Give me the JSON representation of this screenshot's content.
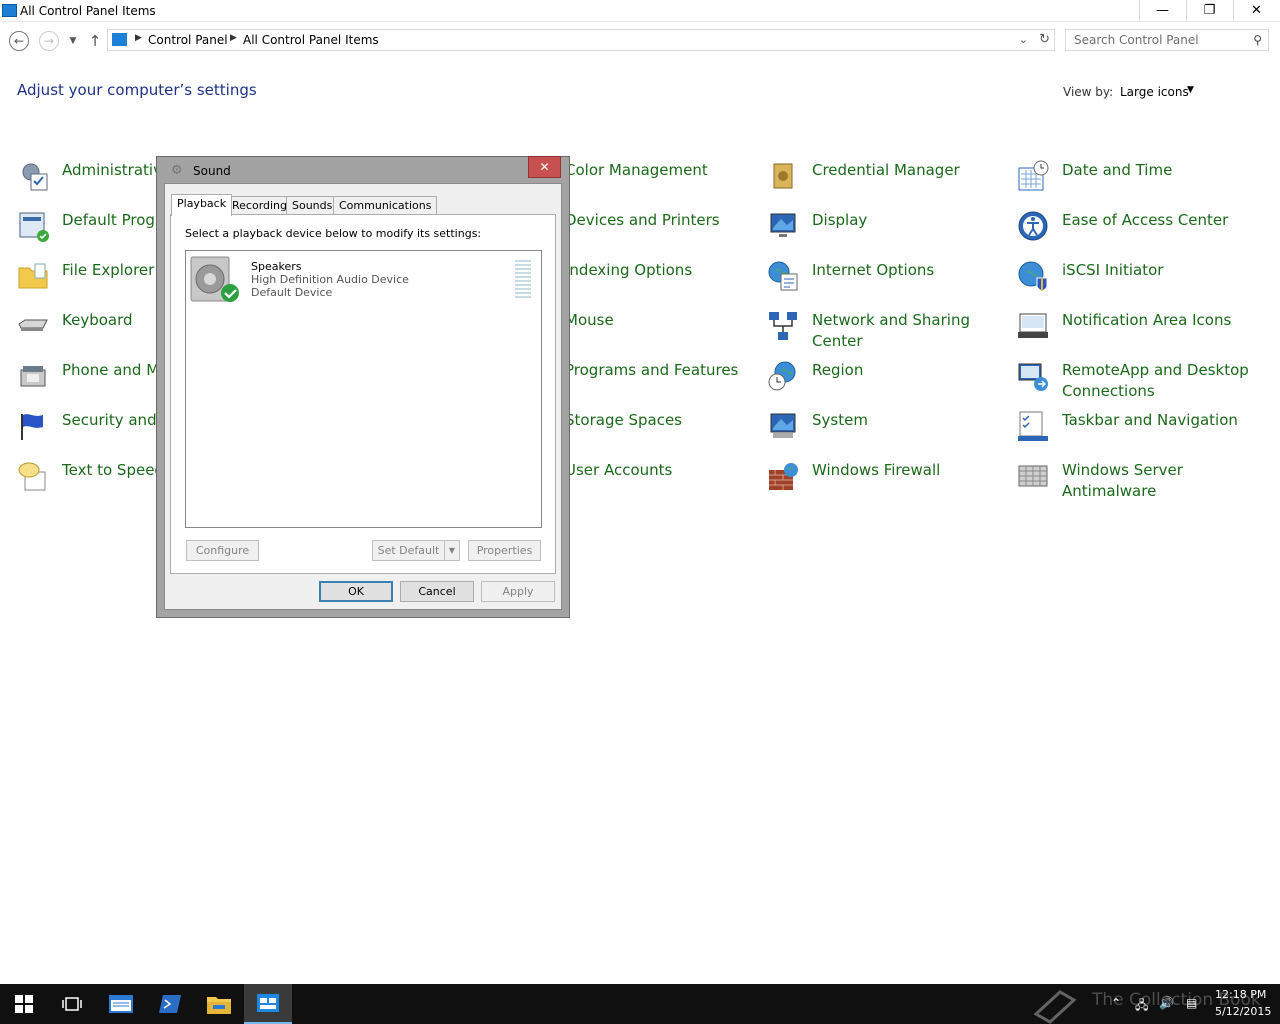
{
  "window": {
    "title": "All Control Panel Items",
    "minimize": "—",
    "restore": "❐",
    "close": "✕"
  },
  "address_bar": {
    "crumbs": [
      "Control Panel",
      "All Control Panel Items"
    ],
    "search_placeholder": "Search Control Panel"
  },
  "header": {
    "title": "Adjust your computer’s settings",
    "view_by_label": "View by:",
    "view_by_value": "Large icons"
  },
  "items": {
    "col1": [
      "Administrative",
      "Default Progr",
      "File Explorer O",
      "Keyboard",
      "Phone and M",
      "Security and M",
      "Text to Speech"
    ],
    "col2": [
      "Color Management",
      "Devices and Printers",
      "Indexing Options",
      "Mouse",
      "Programs and Features",
      "Storage Spaces",
      "User Accounts"
    ],
    "col3": [
      "Credential Manager",
      "Display",
      "Internet Options",
      "Network and Sharing Center",
      "Region",
      "System",
      "Windows Firewall"
    ],
    "col4": [
      "Date and Time",
      "Ease of Access Center",
      "iSCSI Initiator",
      "Notification Area Icons",
      "RemoteApp and Desktop Connections",
      "Taskbar and Navigation",
      "Windows Server Antimalware"
    ]
  },
  "dialog": {
    "title": "Sound",
    "close": "✕",
    "tabs": [
      "Playback",
      "Recording",
      "Sounds",
      "Communications"
    ],
    "instruction": "Select a playback device below to modify its settings:",
    "device": {
      "name": "Speakers",
      "driver": "High Definition Audio Device",
      "status": "Default Device"
    },
    "buttons": {
      "configure": "Configure",
      "set_default": "Set Default",
      "properties": "Properties",
      "ok": "OK",
      "cancel": "Cancel",
      "apply": "Apply"
    }
  },
  "taskbar": {
    "watermark": "The Collection Book",
    "time": "12:18 PM",
    "date": "5/12/2015"
  },
  "colors": {
    "link_green": "#1a6a1a",
    "title_blue": "#1e3287",
    "dialog_close_red": "#c75050",
    "taskbar": "#101010"
  },
  "icons": [
    "app-icon",
    "back-arrow-icon",
    "forward-arrow-icon",
    "up-arrow-icon",
    "refresh-icon",
    "search-icon",
    "speaker-icon",
    "default-check-icon",
    "windows-start-icon",
    "task-view-icon",
    "server-manager-icon",
    "powershell-icon",
    "file-explorer-icon",
    "control-panel-icon"
  ]
}
